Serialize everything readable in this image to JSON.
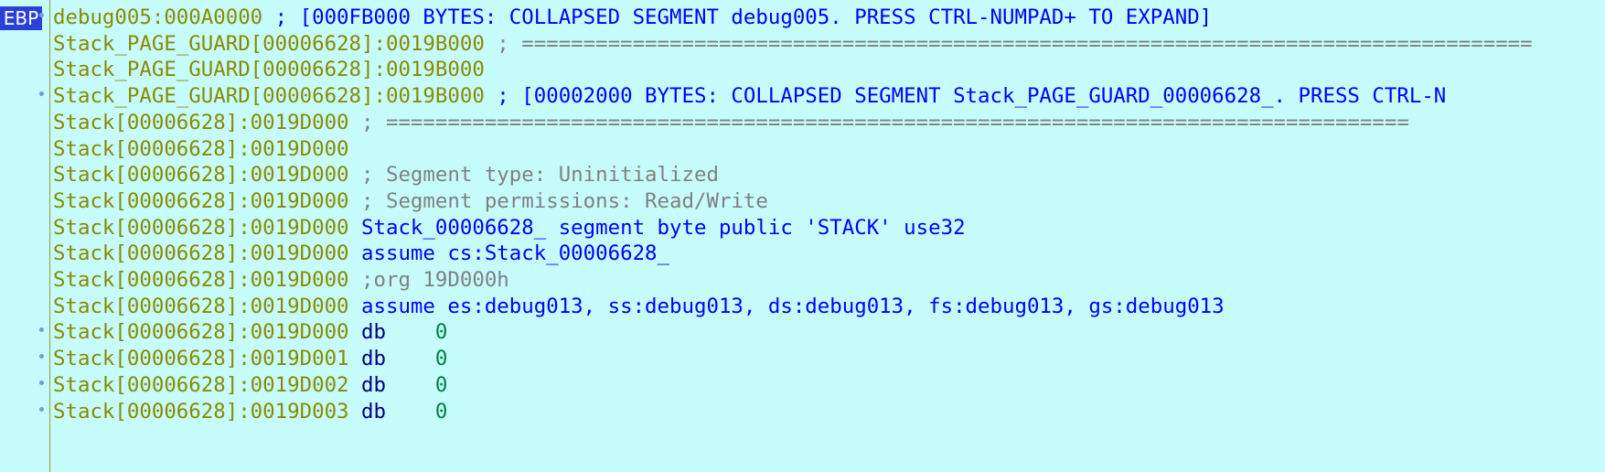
{
  "badge": "EBP",
  "rows": [
    {
      "addr": "debug005:000A0000",
      "text": " ; [000FB000 BYTES: COLLAPSED SEGMENT debug005. PRESS CTRL-NUMPAD+ TO EXPAND]",
      "kind": "blue",
      "dot": true
    },
    {
      "addr": "Stack_PAGE_GUARD[00006628]:0019B000",
      "text": " ; ==================================================================================",
      "kind": "gray",
      "dot": false
    },
    {
      "addr": "Stack_PAGE_GUARD[00006628]:0019B000",
      "text": "",
      "kind": "gray",
      "dot": false
    },
    {
      "addr": "Stack_PAGE_GUARD[00006628]:0019B000",
      "text": " ; [00002000 BYTES: COLLAPSED SEGMENT Stack_PAGE_GUARD_00006628_. PRESS CTRL-N",
      "kind": "blue",
      "dot": true
    },
    {
      "addr": "Stack[00006628]:0019D000",
      "text": " ; ===================================================================================",
      "kind": "gray",
      "dot": false
    },
    {
      "addr": "Stack[00006628]:0019D000",
      "text": "",
      "kind": "gray",
      "dot": false
    },
    {
      "addr": "Stack[00006628]:0019D000",
      "text": " ; Segment type: Uninitialized",
      "kind": "gray",
      "dot": false
    },
    {
      "addr": "Stack[00006628]:0019D000",
      "text": " ; Segment permissions: Read/Write",
      "kind": "gray",
      "dot": false
    },
    {
      "addr": "Stack[00006628]:0019D000",
      "text": " Stack_00006628_ segment byte public 'STACK' use32",
      "kind": "blue",
      "dot": false
    },
    {
      "addr": "Stack[00006628]:0019D000",
      "text": " assume cs:Stack_00006628_",
      "kind": "blue",
      "dot": false
    },
    {
      "addr": "Stack[00006628]:0019D000",
      "text": " ;org 19D000h",
      "kind": "gray",
      "dot": false
    },
    {
      "addr": "Stack[00006628]:0019D000",
      "text": " assume es:debug013, ss:debug013, ds:debug013, fs:debug013, gs:debug013",
      "kind": "blue",
      "dot": false
    },
    {
      "addr": "Stack[00006628]:0019D000",
      "mnem": " db",
      "val": "0",
      "kind": "data",
      "dot": true
    },
    {
      "addr": "Stack[00006628]:0019D001",
      "mnem": " db",
      "val": "0",
      "kind": "data",
      "dot": true
    },
    {
      "addr": "Stack[00006628]:0019D002",
      "mnem": " db",
      "val": "0",
      "kind": "data",
      "dot": true
    },
    {
      "addr": "Stack[00006628]:0019D003",
      "mnem": " db",
      "val": "0",
      "kind": "data",
      "dot": true
    }
  ]
}
